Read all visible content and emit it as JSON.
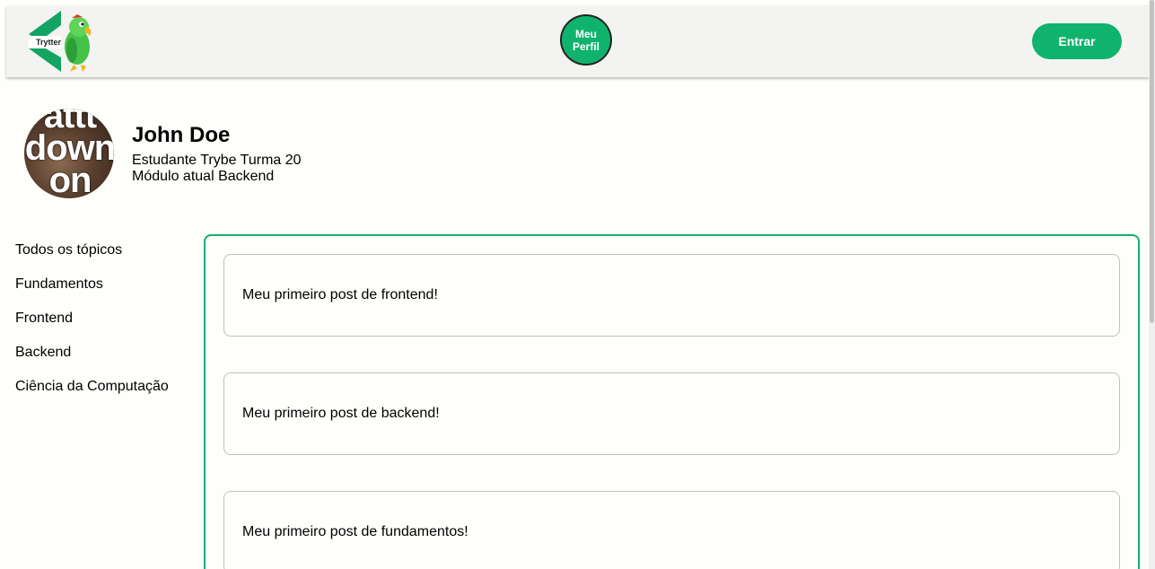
{
  "header": {
    "logo_text": "Trytter",
    "profile_button_label": "Meu Perfil",
    "login_button_label": "Entrar",
    "accent_color": "#0fb36e"
  },
  "profile": {
    "avatar_text": "attt down on",
    "name": "John Doe",
    "description": "Estudante Trybe Turma 20",
    "module": "Módulo atual Backend"
  },
  "sidebar": {
    "topics": [
      {
        "label": "Todos os tópicos"
      },
      {
        "label": "Fundamentos"
      },
      {
        "label": "Frontend"
      },
      {
        "label": "Backend"
      },
      {
        "label": "Ciência da Computação"
      }
    ]
  },
  "feed": {
    "posts": [
      {
        "text": "Meu primeiro post de frontend!"
      },
      {
        "text": "Meu primeiro post de backend!"
      },
      {
        "text": "Meu primeiro post de fundamentos!"
      }
    ]
  }
}
